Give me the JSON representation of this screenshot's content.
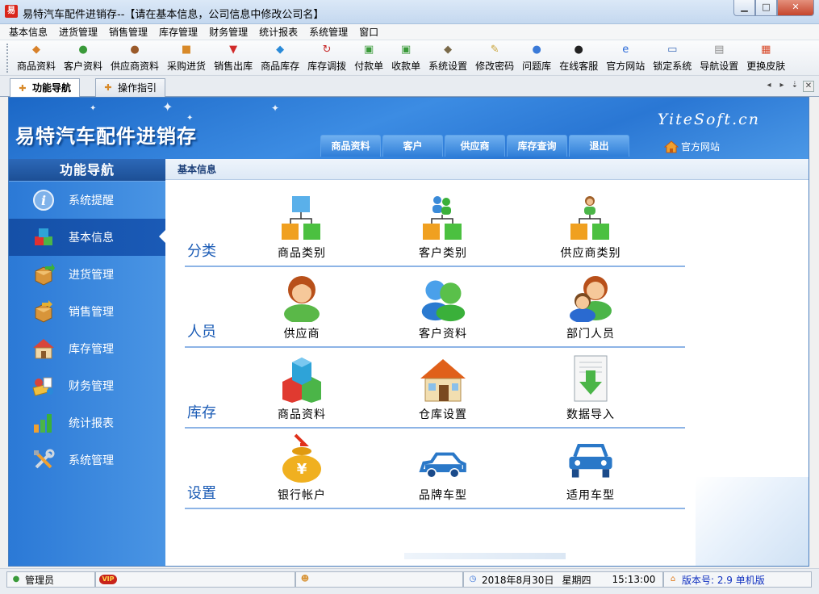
{
  "window": {
    "icon_text": "易",
    "title": "易特汽车配件进销存--【请在基本信息，公司信息中修改公司名】",
    "buttons": {
      "minimize": "▁",
      "maximize": "□",
      "close": "✕"
    }
  },
  "menu": [
    "基本信息",
    "进货管理",
    "销售管理",
    "库存管理",
    "财务管理",
    "统计报表",
    "系统管理",
    "窗口"
  ],
  "toolbar": [
    {
      "label": "商品资料",
      "icon": "box-icon",
      "glyph": "◆",
      "color": "#d8812a"
    },
    {
      "label": "客户资料",
      "icon": "customers-icon",
      "glyph": "●",
      "color": "#3a9a3a"
    },
    {
      "label": "供应商资料",
      "icon": "supplier-icon",
      "glyph": "●",
      "color": "#9a5a2a"
    },
    {
      "label": "采购进货",
      "icon": "truck-icon",
      "glyph": "■",
      "color": "#d88a2a"
    },
    {
      "label": "销售出库",
      "icon": "basket-icon",
      "glyph": "▼",
      "color": "#d12a2a"
    },
    {
      "label": "商品库存",
      "icon": "stock-icon",
      "glyph": "◆",
      "color": "#2a8ad8"
    },
    {
      "label": "库存调拨",
      "icon": "transfer-icon",
      "glyph": "↻",
      "color": "#c72a2a"
    },
    {
      "label": "付款单",
      "icon": "payment-icon",
      "glyph": "▣",
      "color": "#3a9a3a"
    },
    {
      "label": "收款单",
      "icon": "receipt-icon",
      "glyph": "▣",
      "color": "#3a9a3a"
    },
    {
      "label": "系统设置",
      "icon": "settings-icon",
      "glyph": "◆",
      "color": "#7a6a4a"
    },
    {
      "label": "修改密码",
      "icon": "key-icon",
      "glyph": "✎",
      "color": "#c9a43a"
    },
    {
      "label": "问题库",
      "icon": "qa-icon",
      "glyph": "●",
      "color": "#3a7ad8"
    },
    {
      "label": "在线客服",
      "icon": "qq-icon",
      "glyph": "●",
      "color": "#222222"
    },
    {
      "label": "官方网站",
      "icon": "ie-icon",
      "glyph": "e",
      "color": "#2a6ad8"
    },
    {
      "label": "锁定系统",
      "icon": "lock-icon",
      "glyph": "▭",
      "color": "#3a6ab8"
    },
    {
      "label": "导航设置",
      "icon": "nav-settings-icon",
      "glyph": "▤",
      "color": "#8a8a8a"
    },
    {
      "label": "更换皮肤",
      "icon": "skin-icon",
      "glyph": "▦",
      "color": "#d84a2a"
    }
  ],
  "tabs": [
    {
      "label": "功能导航",
      "active": true
    },
    {
      "label": "操作指引",
      "active": false
    }
  ],
  "header": {
    "title": "易特汽车配件进销存",
    "brand": "YiteSoft.cn",
    "tabs": [
      "商品资料",
      "客户",
      "供应商",
      "库存查询",
      "退出"
    ],
    "official_site": "官方网站"
  },
  "sidebar": {
    "title": "功能导航",
    "items": [
      {
        "label": "系统提醒",
        "icon": "info-icon",
        "active": false
      },
      {
        "label": "基本信息",
        "icon": "cubes-icon",
        "active": true
      },
      {
        "label": "进货管理",
        "icon": "inbound-box-icon",
        "active": false
      },
      {
        "label": "销售管理",
        "icon": "outbound-box-icon",
        "active": false
      },
      {
        "label": "库存管理",
        "icon": "warehouse-icon",
        "active": false
      },
      {
        "label": "财务管理",
        "icon": "finance-icon",
        "active": false
      },
      {
        "label": "统计报表",
        "icon": "bar-chart-icon",
        "active": false
      },
      {
        "label": "系统管理",
        "icon": "tools-icon",
        "active": false
      }
    ]
  },
  "content": {
    "breadcrumb": "基本信息",
    "rows": [
      {
        "label": "分类",
        "items": [
          {
            "label": "商品类别",
            "icon": "category-tree-icon"
          },
          {
            "label": "客户类别",
            "icon": "customer-tree-icon"
          },
          {
            "label": "供应商类别",
            "icon": "supplier-tree-icon"
          }
        ]
      },
      {
        "label": "人员",
        "items": [
          {
            "label": "供应商",
            "icon": "supplier-person-icon"
          },
          {
            "label": "客户资料",
            "icon": "customer-people-icon"
          },
          {
            "label": "部门人员",
            "icon": "staff-people-icon"
          }
        ]
      },
      {
        "label": "库存",
        "items": [
          {
            "label": "商品资料",
            "icon": "product-cubes-icon"
          },
          {
            "label": "仓库设置",
            "icon": "warehouse-house-icon"
          },
          {
            "label": "数据导入",
            "icon": "import-document-icon"
          }
        ]
      },
      {
        "label": "设置",
        "items": [
          {
            "label": "银行帐户",
            "icon": "money-bag-icon",
            "bag_glyph": "¥"
          },
          {
            "label": "品牌车型",
            "icon": "car-icon"
          },
          {
            "label": "适用车型",
            "icon": "car-front-icon"
          }
        ]
      }
    ]
  },
  "statusbar": {
    "user": "管理员",
    "vip": "VIP",
    "date": "2018年8月30日",
    "weekday": "星期四",
    "time": "15:13:00",
    "version": "版本号: 2.9 单机版"
  },
  "colors": {
    "header_blue": "#2a77d4",
    "sidebar_blue": "#3a87de",
    "row_label_blue": "#1a5bb5",
    "row_line": "#8db4e6"
  }
}
